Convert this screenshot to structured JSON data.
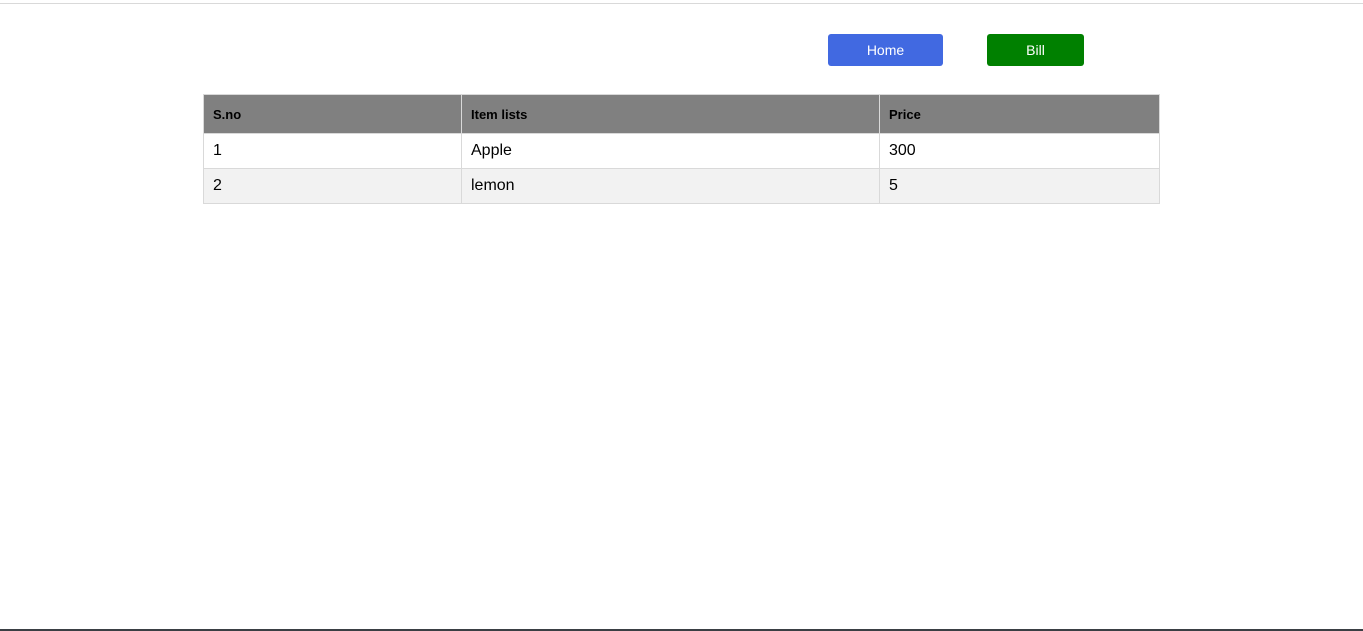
{
  "nav": {
    "home_label": "Home",
    "bill_label": "Bill"
  },
  "table": {
    "headers": [
      "S.no",
      "Item lists",
      "Price"
    ],
    "rows": [
      [
        "1",
        "Apple",
        "300"
      ],
      [
        "2",
        "lemon",
        "5"
      ]
    ]
  },
  "colors": {
    "home_button": "#4169e1",
    "bill_button": "#008000",
    "header_bg": "#808080",
    "alt_row_bg": "#f2f2f2"
  }
}
